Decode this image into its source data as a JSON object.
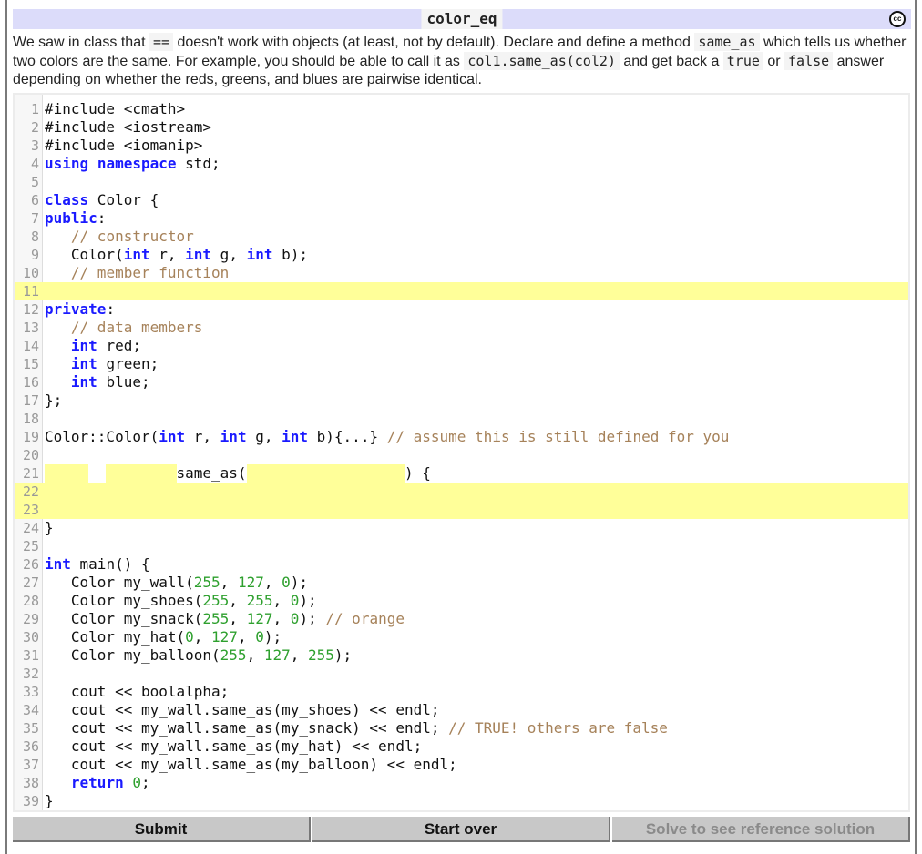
{
  "header": {
    "title": "color_eq",
    "license_icon": "creative-commons-icon",
    "license_label": "cc"
  },
  "description": {
    "segments": [
      {
        "type": "text",
        "value": "We saw in class that "
      },
      {
        "type": "code",
        "value": "=="
      },
      {
        "type": "text",
        "value": " doesn't work with objects (at least, not by default). Declare and define a method "
      },
      {
        "type": "code",
        "value": "same_as"
      },
      {
        "type": "text",
        "value": " which tells us whether two colors are the same. For example, you should be able to call it as "
      },
      {
        "type": "code",
        "value": "col1.same_as(col2)"
      },
      {
        "type": "text",
        "value": " and get back a "
      },
      {
        "type": "code",
        "value": "true"
      },
      {
        "type": "text",
        "value": " or "
      },
      {
        "type": "code",
        "value": "false"
      },
      {
        "type": "text",
        "value": " answer depending on whether the reds, greens, and blues are pairwise identical."
      }
    ]
  },
  "editor": {
    "lines": [
      {
        "n": "1",
        "tokens": [
          [
            "",
            "#include <cmath>"
          ]
        ]
      },
      {
        "n": "2",
        "tokens": [
          [
            "",
            "#include <iostream>"
          ]
        ]
      },
      {
        "n": "3",
        "tokens": [
          [
            "",
            "#include <iomanip>"
          ]
        ]
      },
      {
        "n": "4",
        "tokens": [
          [
            "kw",
            "using"
          ],
          [
            "",
            " "
          ],
          [
            "kw",
            "namespace"
          ],
          [
            "",
            " std;"
          ]
        ]
      },
      {
        "n": "5",
        "tokens": []
      },
      {
        "n": "6",
        "tokens": [
          [
            "kw",
            "class"
          ],
          [
            "",
            " Color {"
          ]
        ]
      },
      {
        "n": "7",
        "tokens": [
          [
            "kw",
            "public"
          ],
          [
            "",
            ":"
          ]
        ]
      },
      {
        "n": "8",
        "tokens": [
          [
            "",
            "   "
          ],
          [
            "cm",
            "// constructor"
          ]
        ]
      },
      {
        "n": "9",
        "tokens": [
          [
            "",
            "   Color("
          ],
          [
            "kw",
            "int"
          ],
          [
            "",
            " r, "
          ],
          [
            "kw",
            "int"
          ],
          [
            "",
            " g, "
          ],
          [
            "kw",
            "int"
          ],
          [
            "",
            " b);"
          ]
        ]
      },
      {
        "n": "10",
        "tokens": [
          [
            "",
            "   "
          ],
          [
            "cm",
            "// member function"
          ]
        ]
      },
      {
        "n": "11",
        "tokens": [],
        "blank_line": true
      },
      {
        "n": "12",
        "tokens": [
          [
            "kw",
            "private"
          ],
          [
            "",
            ":"
          ]
        ]
      },
      {
        "n": "13",
        "tokens": [
          [
            "",
            "   "
          ],
          [
            "cm",
            "// data members"
          ]
        ]
      },
      {
        "n": "14",
        "tokens": [
          [
            "",
            "   "
          ],
          [
            "kw",
            "int"
          ],
          [
            "",
            " red;"
          ]
        ]
      },
      {
        "n": "15",
        "tokens": [
          [
            "",
            "   "
          ],
          [
            "kw",
            "int"
          ],
          [
            "",
            " green;"
          ]
        ]
      },
      {
        "n": "16",
        "tokens": [
          [
            "",
            "   "
          ],
          [
            "kw",
            "int"
          ],
          [
            "",
            " blue;"
          ]
        ]
      },
      {
        "n": "17",
        "tokens": [
          [
            "",
            "};"
          ]
        ]
      },
      {
        "n": "18",
        "tokens": []
      },
      {
        "n": "19",
        "tokens": [
          [
            "",
            "Color::Color("
          ],
          [
            "kw",
            "int"
          ],
          [
            "",
            " r, "
          ],
          [
            "kw",
            "int"
          ],
          [
            "",
            " g, "
          ],
          [
            "kw",
            "int"
          ],
          [
            "",
            " b){...} "
          ],
          [
            "cm",
            "// assume this is still defined for you"
          ]
        ]
      },
      {
        "n": "20",
        "tokens": []
      },
      {
        "n": "21",
        "tokens": [
          [
            "blank",
            "     "
          ],
          [
            "",
            "  "
          ],
          [
            "blank",
            "        "
          ],
          [
            "",
            "same_as("
          ],
          [
            "blank",
            "                  "
          ],
          [
            "",
            ") {"
          ]
        ]
      },
      {
        "n": "22",
        "tokens": [],
        "blank_line": true
      },
      {
        "n": "23",
        "tokens": [],
        "blank_line": true
      },
      {
        "n": "24",
        "tokens": [
          [
            "",
            "}"
          ]
        ]
      },
      {
        "n": "25",
        "tokens": []
      },
      {
        "n": "26",
        "tokens": [
          [
            "kw",
            "int"
          ],
          [
            "",
            " main() {"
          ]
        ]
      },
      {
        "n": "27",
        "tokens": [
          [
            "",
            "   Color my_wall("
          ],
          [
            "num",
            "255"
          ],
          [
            "",
            ", "
          ],
          [
            "num",
            "127"
          ],
          [
            "",
            ", "
          ],
          [
            "num",
            "0"
          ],
          [
            "",
            ");"
          ]
        ]
      },
      {
        "n": "28",
        "tokens": [
          [
            "",
            "   Color my_shoes("
          ],
          [
            "num",
            "255"
          ],
          [
            "",
            ", "
          ],
          [
            "num",
            "255"
          ],
          [
            "",
            ", "
          ],
          [
            "num",
            "0"
          ],
          [
            "",
            ");"
          ]
        ]
      },
      {
        "n": "29",
        "tokens": [
          [
            "",
            "   Color my_snack("
          ],
          [
            "num",
            "255"
          ],
          [
            "",
            ", "
          ],
          [
            "num",
            "127"
          ],
          [
            "",
            ", "
          ],
          [
            "num",
            "0"
          ],
          [
            "",
            "); "
          ],
          [
            "cm",
            "// orange"
          ]
        ]
      },
      {
        "n": "30",
        "tokens": [
          [
            "",
            "   Color my_hat("
          ],
          [
            "num",
            "0"
          ],
          [
            "",
            ", "
          ],
          [
            "num",
            "127"
          ],
          [
            "",
            ", "
          ],
          [
            "num",
            "0"
          ],
          [
            "",
            ");"
          ]
        ]
      },
      {
        "n": "31",
        "tokens": [
          [
            "",
            "   Color my_balloon("
          ],
          [
            "num",
            "255"
          ],
          [
            "",
            ", "
          ],
          [
            "num",
            "127"
          ],
          [
            "",
            ", "
          ],
          [
            "num",
            "255"
          ],
          [
            "",
            ");"
          ]
        ]
      },
      {
        "n": "32",
        "tokens": []
      },
      {
        "n": "33",
        "tokens": [
          [
            "",
            "   cout << boolalpha;"
          ]
        ]
      },
      {
        "n": "34",
        "tokens": [
          [
            "",
            "   cout << my_wall.same_as(my_shoes) << endl;"
          ]
        ]
      },
      {
        "n": "35",
        "tokens": [
          [
            "",
            "   cout << my_wall.same_as(my_snack) << endl; "
          ],
          [
            "cm",
            "// TRUE! others are false"
          ]
        ]
      },
      {
        "n": "36",
        "tokens": [
          [
            "",
            "   cout << my_wall.same_as(my_hat) << endl;"
          ]
        ]
      },
      {
        "n": "37",
        "tokens": [
          [
            "",
            "   cout << my_wall.same_as(my_balloon) << endl;"
          ]
        ]
      },
      {
        "n": "38",
        "tokens": [
          [
            "",
            "   "
          ],
          [
            "kw",
            "return"
          ],
          [
            "",
            " "
          ],
          [
            "num",
            "0"
          ],
          [
            "",
            ";"
          ]
        ]
      },
      {
        "n": "39",
        "tokens": [
          [
            "",
            "}"
          ]
        ]
      }
    ],
    "blank_inputs": [
      {
        "line": "11",
        "value": ""
      },
      {
        "line": "21",
        "slot": "return-type",
        "value": ""
      },
      {
        "line": "21",
        "slot": "class-scope",
        "value": ""
      },
      {
        "line": "21",
        "slot": "parameters",
        "value": ""
      },
      {
        "line": "22-23",
        "value": ""
      }
    ]
  },
  "buttons": {
    "submit": "Submit",
    "start_over": "Start over",
    "solution": "Solve to see reference solution"
  },
  "colors": {
    "header_bg": "#dcdcfa",
    "blank_highlight": "#ffff99",
    "keyword": "#1a1aff",
    "comment": "#a6825a",
    "number": "#2ea02e"
  }
}
